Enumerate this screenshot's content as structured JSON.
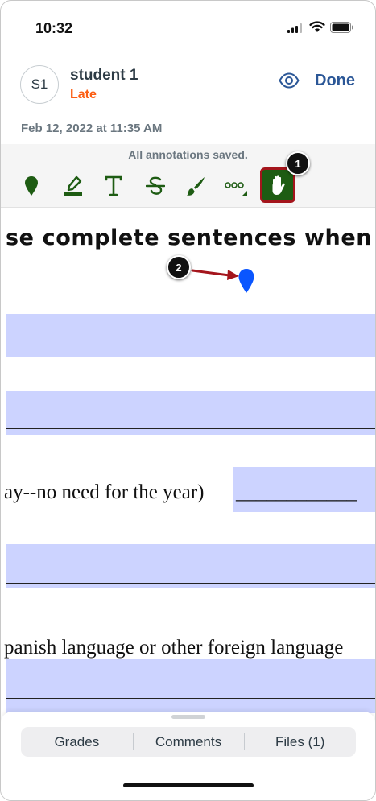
{
  "status_bar": {
    "time": "10:32"
  },
  "header": {
    "avatar_initials": "S1",
    "student_name": "student 1",
    "status": "Late",
    "done_label": "Done",
    "timestamp": "Feb 12, 2022 at 11:35 AM"
  },
  "annotations": {
    "saved_message": "All annotations saved."
  },
  "toolbar": {
    "tools": [
      "point-pin-icon",
      "highlight-icon",
      "text-icon",
      "strikethrough-icon",
      "free-draw-icon",
      "more-icon",
      "pan-hand-icon"
    ],
    "selected": "pan-hand-icon"
  },
  "callouts": {
    "one": "1",
    "two": "2"
  },
  "document": {
    "heading_fragment": "se complete sentences when r",
    "line_1": "ay--no need for the year)",
    "line_1_blank": "____________",
    "line_2": "panish language or other foreign language"
  },
  "bottom_tabs": {
    "grades": "Grades",
    "comments": "Comments",
    "files": "Files (1)"
  },
  "colors": {
    "accent_blue": "#2b5797",
    "late_orange": "#fc5e13",
    "tool_green": "#1e5c13",
    "callout_red": "#a4151c",
    "highlight": "#ccd3ff",
    "pin_blue": "#0a56ff"
  }
}
